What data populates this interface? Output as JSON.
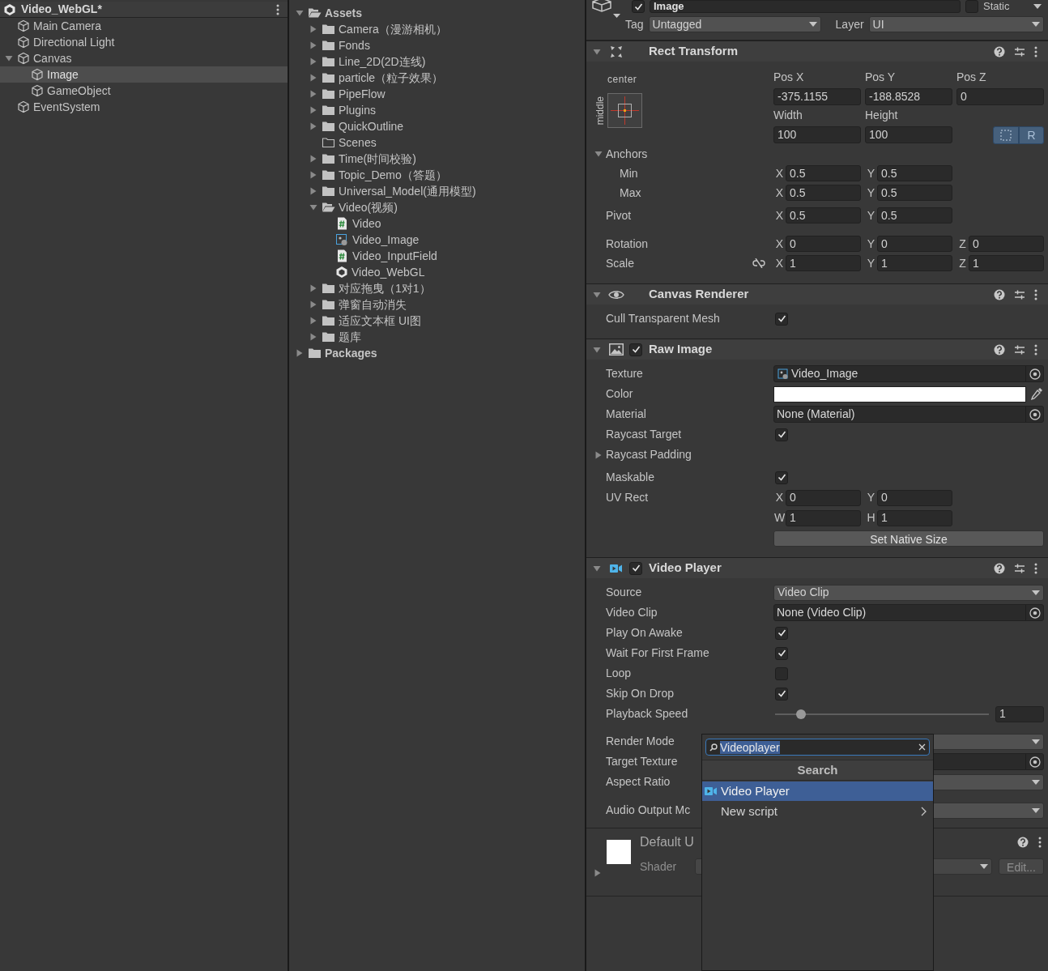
{
  "hierarchy": {
    "title": "Video_WebGL*",
    "items": [
      {
        "label": "Main Camera",
        "selected": false
      },
      {
        "label": "Directional Light",
        "selected": false
      },
      {
        "label": "Canvas",
        "selected": false,
        "expanded": true,
        "children": [
          {
            "label": "Image",
            "selected": true
          },
          {
            "label": "GameObject",
            "selected": false
          }
        ]
      },
      {
        "label": "EventSystem",
        "selected": false
      }
    ]
  },
  "project": {
    "items": [
      {
        "label": "Assets",
        "kind": "folder",
        "selected": false,
        "expanded": true,
        "children": [
          {
            "label": "Camera（漫游相机）",
            "kind": "folder",
            "selected": false,
            "expanded": false
          },
          {
            "label": "Fonds",
            "kind": "folder",
            "selected": false,
            "expanded": false
          },
          {
            "label": "Line_2D(2D连线)",
            "kind": "folder",
            "selected": false,
            "expanded": false
          },
          {
            "label": "particle（粒子效果）",
            "kind": "folder",
            "selected": false,
            "expanded": false
          },
          {
            "label": "PipeFlow",
            "kind": "folder",
            "selected": false,
            "expanded": false
          },
          {
            "label": "Plugins",
            "kind": "folder",
            "selected": false,
            "expanded": false
          },
          {
            "label": "QuickOutline",
            "kind": "folder",
            "selected": false,
            "expanded": false
          },
          {
            "label": "Scenes",
            "kind": "empty_folder",
            "selected": false
          },
          {
            "label": "Time(时间校验)",
            "kind": "folder",
            "selected": false,
            "expanded": false
          },
          {
            "label": "Topic_Demo（答题）",
            "kind": "folder",
            "selected": false,
            "expanded": false
          },
          {
            "label": "Universal_Model(通用模型)",
            "kind": "folder",
            "selected": false,
            "expanded": false
          },
          {
            "label": "Video(视频)",
            "kind": "folder",
            "selected": false,
            "expanded": true,
            "children": [
              {
                "label": "Video",
                "kind": "script",
                "selected": false
              },
              {
                "label": "Video_Image",
                "kind": "texture",
                "selected": false
              },
              {
                "label": "Video_InputField",
                "kind": "script",
                "selected": false
              },
              {
                "label": "Video_WebGL",
                "kind": "scene",
                "selected": false
              }
            ]
          },
          {
            "label": "对应拖曳（1对1）",
            "kind": "folder",
            "selected": false,
            "expanded": false
          },
          {
            "label": "弹窗自动消失",
            "kind": "folder",
            "selected": false,
            "expanded": false
          },
          {
            "label": "适应文本框 UI图",
            "kind": "folder",
            "selected": false,
            "expanded": false
          },
          {
            "label": "题库",
            "kind": "folder",
            "selected": false,
            "expanded": false
          }
        ]
      },
      {
        "label": "Packages",
        "kind": "folder",
        "selected": false,
        "expanded": false
      }
    ]
  },
  "inspector": {
    "header": {
      "active": true,
      "name": "Image",
      "static": false,
      "static_label": "Static",
      "tag_label": "Tag",
      "tag": "Untagged",
      "layer_label": "Layer",
      "layer": "UI"
    },
    "components": [
      {
        "kind": "rect_transform",
        "title": "Rect Transform",
        "expanded": true,
        "anchor_preset": {
          "horizontal": "center",
          "vertical": "middle"
        },
        "position": [
          {
            "label": "Pos X",
            "value": "-375.1155"
          },
          {
            "label": "Pos Y",
            "value": "-188.8528"
          },
          {
            "label": "Pos Z",
            "value": "0"
          }
        ],
        "size": [
          {
            "label": "Width",
            "value": "100"
          },
          {
            "label": "Height",
            "value": "100"
          }
        ],
        "blueprint_mode": true,
        "raw_edit_mode": true,
        "raw_edit_label": "R",
        "anchors": {
          "label": "Anchors",
          "expanded": true,
          "rows": [
            {
              "label": "Min",
              "fields": [
                {
                  "axis": "X",
                  "value": "0.5"
                },
                {
                  "axis": "Y",
                  "value": "0.5"
                }
              ]
            },
            {
              "label": "Max",
              "fields": [
                {
                  "axis": "X",
                  "value": "0.5"
                },
                {
                  "axis": "Y",
                  "value": "0.5"
                }
              ]
            }
          ]
        },
        "rows": [
          {
            "label": "Pivot",
            "fields": [
              {
                "axis": "X",
                "value": "0.5"
              },
              {
                "axis": "Y",
                "value": "0.5"
              }
            ]
          },
          {
            "label": "Rotation",
            "fields": [
              {
                "axis": "X",
                "value": "0"
              },
              {
                "axis": "Y",
                "value": "0"
              },
              {
                "axis": "Z",
                "value": "0"
              }
            ]
          },
          {
            "label": "Scale",
            "constrain_proportions": false,
            "fields": [
              {
                "axis": "X",
                "value": "1"
              },
              {
                "axis": "Y",
                "value": "1"
              },
              {
                "axis": "Z",
                "value": "1"
              }
            ]
          }
        ]
      },
      {
        "kind": "canvas_renderer",
        "title": "Canvas Renderer",
        "expanded": true,
        "rows": [
          {
            "kind": "checkbox",
            "label": "Cull Transparent Mesh",
            "checked": true
          }
        ]
      },
      {
        "kind": "raw_image",
        "title": "Raw Image",
        "enabled": true,
        "expanded": true,
        "rows": [
          {
            "kind": "texture_object",
            "label": "Texture",
            "value": "Video_Image"
          },
          {
            "kind": "color",
            "label": "Color",
            "color": "#ffffff"
          },
          {
            "kind": "object",
            "label": "Material",
            "value": "None (Material)"
          },
          {
            "kind": "checkbox",
            "label": "Raycast Target",
            "checked": true
          },
          {
            "kind": "foldout",
            "label": "Raycast Padding",
            "expanded": false
          },
          {
            "kind": "checkbox",
            "label": "Maskable",
            "checked": true
          },
          {
            "kind": "vector",
            "label": "UV Rect",
            "fields": [
              {
                "axis": "X",
                "value": "0"
              },
              {
                "axis": "Y",
                "value": "0"
              }
            ]
          },
          {
            "kind": "vector",
            "fields": [
              {
                "axis": "W",
                "value": "1"
              },
              {
                "axis": "H",
                "value": "1"
              }
            ]
          },
          {
            "kind": "button",
            "label": "Set Native Size"
          }
        ]
      },
      {
        "kind": "video_player",
        "title": "Video Player",
        "enabled": true,
        "expanded": true,
        "rows": [
          {
            "kind": "dropdown",
            "label": "Source",
            "value": "Video Clip"
          },
          {
            "kind": "object",
            "label": "Video Clip",
            "value": "None (Video Clip)"
          },
          {
            "kind": "checkbox",
            "label": "Play On Awake",
            "checked": true
          },
          {
            "kind": "checkbox",
            "label": "Wait For First Frame",
            "checked": true
          },
          {
            "kind": "checkbox",
            "label": "Loop",
            "checked": false
          },
          {
            "kind": "checkbox",
            "label": "Skip On Drop",
            "checked": true
          },
          {
            "kind": "slider",
            "label": "Playback Speed",
            "level": 0.12,
            "value": "1"
          },
          {
            "kind": "dropdown",
            "label": "Render Mode"
          },
          {
            "kind": "object",
            "label": "Target Texture"
          },
          {
            "kind": "dropdown",
            "label": "Aspect Ratio"
          },
          {
            "kind": "dropdown",
            "label": "Audio Output Mc"
          }
        ]
      }
    ],
    "material": {
      "name": "Default U",
      "shader_label": "Shader",
      "edit_label": "Edit...",
      "expanded": false
    }
  },
  "popup": {
    "search": "Videoplayer",
    "header": "Search",
    "items": [
      {
        "label": "Video Player",
        "kind": "component",
        "selected": true
      },
      {
        "label": "New script",
        "kind": "submenu",
        "selected": false
      }
    ]
  }
}
